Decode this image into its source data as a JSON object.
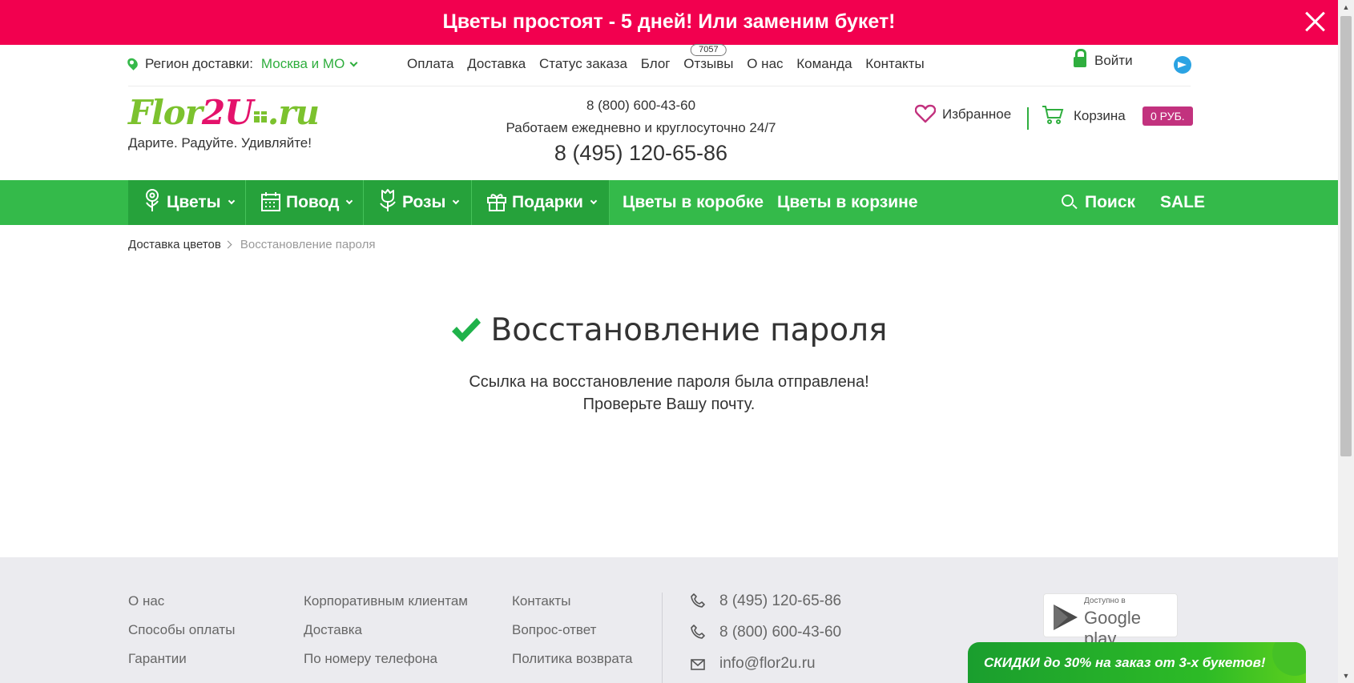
{
  "promo": {
    "text": "Цветы простоят - 5 дней! Или заменим букет!"
  },
  "topline": {
    "region_label": "Регион доставки:",
    "region_city": "Москва и МО",
    "nav": [
      {
        "label": "Оплата"
      },
      {
        "label": "Доставка"
      },
      {
        "label": "Статус заказа"
      },
      {
        "label": "Блог"
      },
      {
        "label": "Отзывы",
        "badge": "7057"
      },
      {
        "label": "О нас"
      },
      {
        "label": "Команда"
      },
      {
        "label": "Контакты"
      }
    ],
    "login": "Войти"
  },
  "header": {
    "logo_part1": "Flor",
    "logo_part2": "2U",
    "logo_part3": ".ru",
    "tagline": "Дарите. Радуйте. Удивляйте!",
    "phone_free": "8 (800) 600-43-60",
    "hours": "Работаем ежедневно и круглосуточно 24/7",
    "phone_main": "8 (495) 120-65-86",
    "favorites": "Избранное",
    "cart": "Корзина",
    "cart_total": "0 РУБ."
  },
  "menu": {
    "items": [
      {
        "label": "Цветы",
        "icon": "flower-icon"
      },
      {
        "label": "Повод",
        "icon": "calendar-icon"
      },
      {
        "label": "Розы",
        "icon": "rose-icon"
      },
      {
        "label": "Подарки",
        "icon": "gift-icon"
      }
    ],
    "links": [
      {
        "label": "Цветы в коробке"
      },
      {
        "label": "Цветы в корзине"
      }
    ],
    "search": "Поиск",
    "sale": "SALE"
  },
  "breadcrumb": {
    "home": "Доставка цветов",
    "current": "Восстановление пароля"
  },
  "content": {
    "title": "Восстановление пароля",
    "message_line1": "Ссылка на восстановление пароля была отправлена!",
    "message_line2": "Проверьте Вашу почту."
  },
  "footer": {
    "col1": [
      "О нас",
      "Способы оплаты",
      "Гарантии"
    ],
    "col2": [
      "Корпоративным клиентам",
      "Доставка",
      "По номеру телефона"
    ],
    "col3": [
      "Контакты",
      "Вопрос-ответ",
      "Политика возврата"
    ],
    "phone1": "8 (495) 120-65-86",
    "phone2": "8 (800) 600-43-60",
    "email": "info@flor2u.ru",
    "gplay_small": "Доступно в",
    "gplay_big": "Google play"
  },
  "discount_banner": "СКИДКИ до 30% на заказ от 3-х букетов!",
  "colors": {
    "promo": "#f2004f",
    "menu_green": "#34ba4a",
    "menu_dark_green": "#26a23b",
    "accent_green": "#2fae3e",
    "pink": "#e4126b",
    "cart_badge": "#c2327e",
    "footer_bg": "#ebebef"
  }
}
